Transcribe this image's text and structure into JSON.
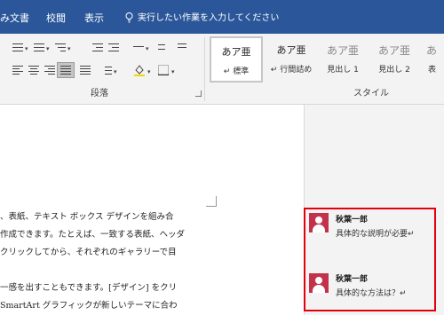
{
  "ribbon_tabs": {
    "review_partial": "み文書",
    "mailings": "校閲",
    "view": "表示",
    "tell_me": "実行したい作業を入力してください"
  },
  "paragraph_group": {
    "label": "段落"
  },
  "styles_group": {
    "label": "スタイル",
    "tiles": [
      {
        "sample": "あア亜",
        "name": "↵ 標準",
        "selected": true
      },
      {
        "sample": "あア亜",
        "name": "↵ 行間詰め",
        "selected": false
      },
      {
        "sample": "あア亜",
        "name": "見出し 1",
        "selected": false
      },
      {
        "sample": "あア亜",
        "name": "見出し 2",
        "selected": false
      },
      {
        "sample": "あ",
        "name": "表",
        "selected": false
      }
    ]
  },
  "document": {
    "lines": [
      "、表紙、テキスト ボックス デザインを組み合",
      "作成できます。たとえば、一致する表紙、ヘッダ",
      "クリックしてから、それぞれのギャラリーで目",
      "一感を出すこともできます。[デザイン] をクリ",
      "SmartArt グラフィックが新しいテーマに合わ"
    ]
  },
  "comments": [
    {
      "author": "秋葉一郎",
      "text": "具体的な説明が必要↵"
    },
    {
      "author": "秋葉一郎",
      "text": "具体的な方法は？↵"
    }
  ],
  "colors": {
    "ribbon_tab_bar": "#2b579a",
    "comment_highlight": "#e3000b",
    "avatar": "#c4314b"
  }
}
